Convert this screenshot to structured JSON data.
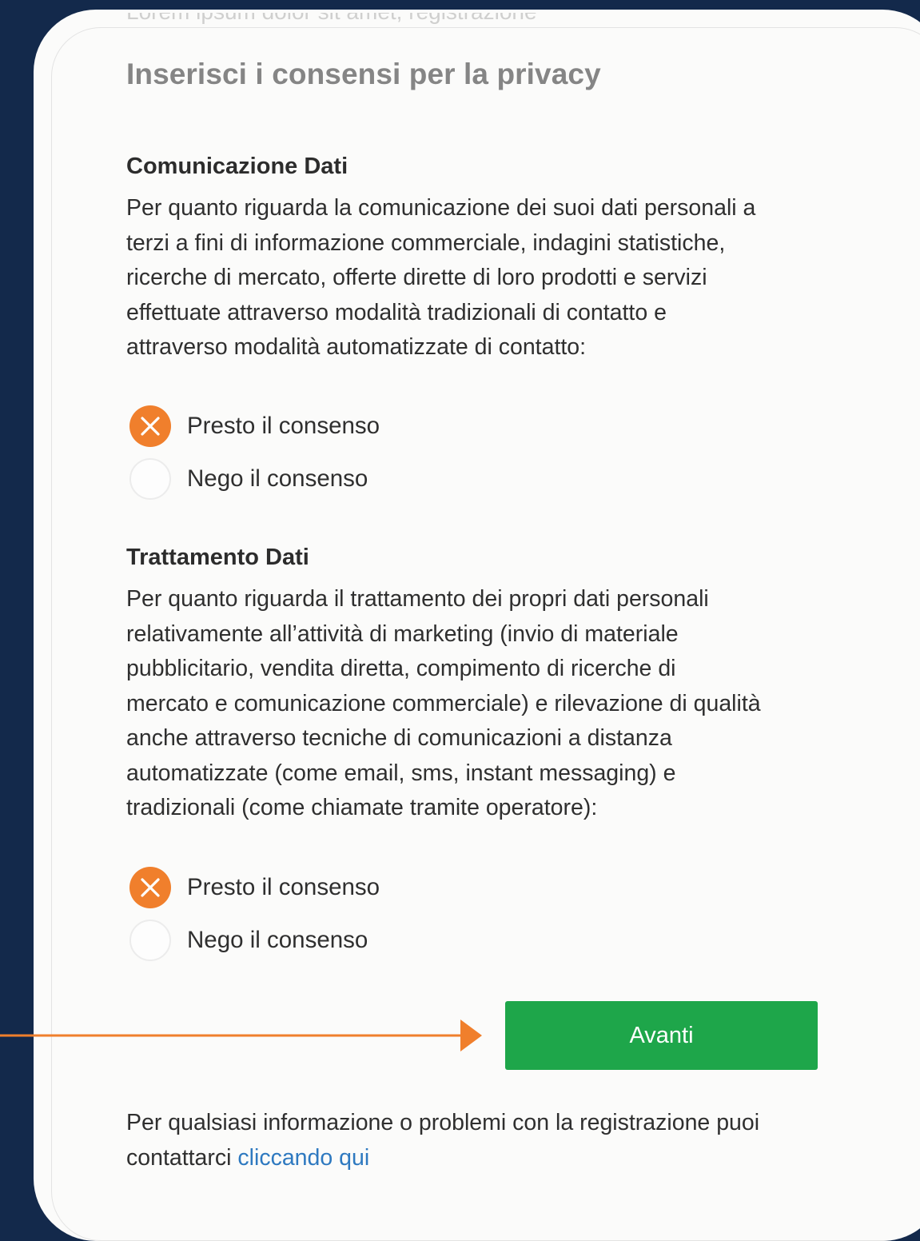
{
  "header": {
    "cutoff_text": "Lorem ipsum dolor sit amet, registrazione",
    "title": "Inserisci i consensi per la privacy"
  },
  "sections": [
    {
      "title": "Comunicazione Dati",
      "lines": [
        "Per quanto riguarda la comunicazione dei suoi dati personali a",
        "terzi a fini di informazione commerciale, indagini statistiche,",
        "ricerche di mercato, offerte dirette di loro prodotti e servizi",
        "effettuate attraverso modalità tradizionali di contatto e",
        "attraverso modalità automatizzate di contatto:"
      ],
      "options": [
        {
          "label": "Presto il consenso",
          "selected": true
        },
        {
          "label": "Nego il consenso",
          "selected": false
        }
      ]
    },
    {
      "title": "Trattamento Dati",
      "lines": [
        "Per quanto riguarda il trattamento dei propri dati personali",
        "relativamente all’attività di marketing (invio di materiale",
        "pubblicitario, vendita diretta, compimento di ricerche di",
        "mercato e comunicazione commerciale) e rilevazione di qualità",
        "anche attraverso tecniche di comunicazioni a distanza",
        "automatizzate (come email, sms, instant messaging) e",
        "tradizionali (come chiamate tramite operatore):"
      ],
      "options": [
        {
          "label": "Presto il consenso",
          "selected": true
        },
        {
          "label": "Nego il consenso",
          "selected": false
        }
      ]
    }
  ],
  "actions": {
    "next_label": "Avanti"
  },
  "footer": {
    "text_before_link": "Per qualsiasi informazione o problemi con la registrazione puoi",
    "text_line2": "contattarci ",
    "link_label": "cliccando qui"
  },
  "icons": {
    "selected_radio": "close-x-icon",
    "annotation": "arrow-right-icon"
  },
  "colors": {
    "background": "#13294b",
    "accent_orange": "#f07f2c",
    "button_green": "#1ea64a",
    "link_blue": "#2e79c0"
  }
}
